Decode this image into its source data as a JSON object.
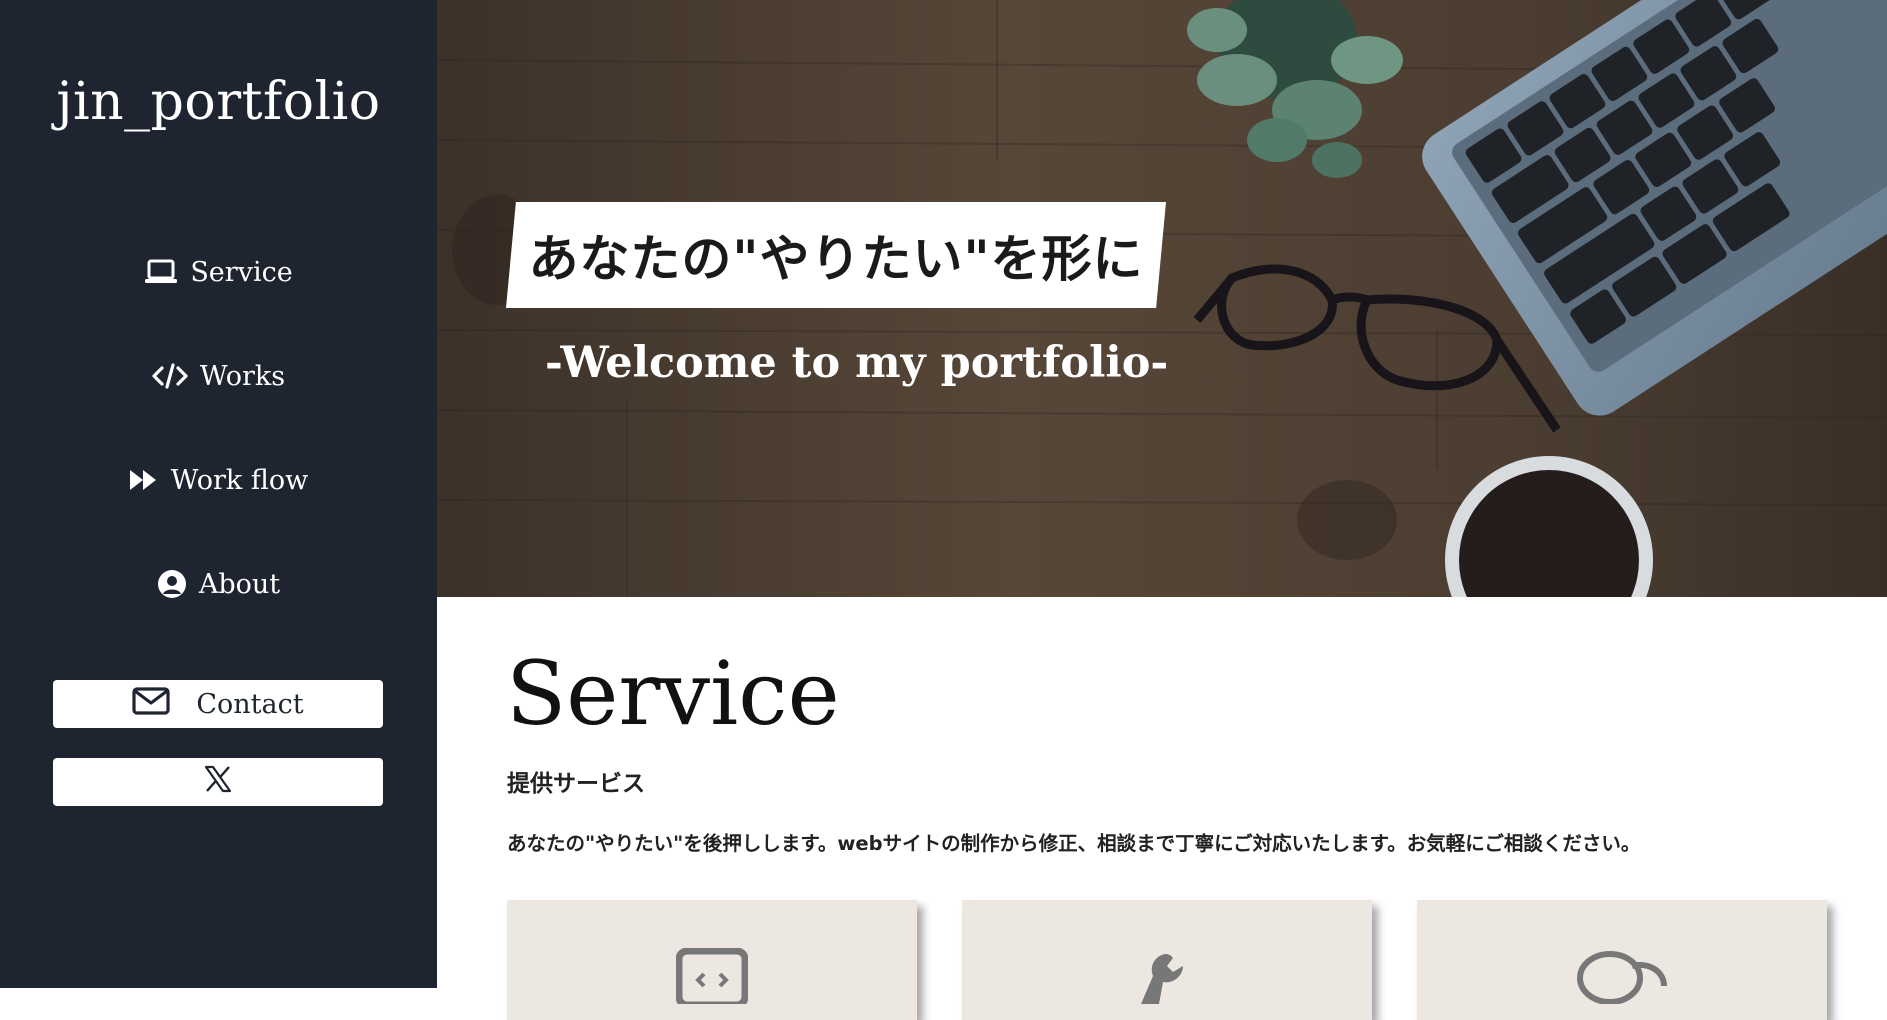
{
  "sidebar": {
    "brand": "jin_portfolio",
    "nav": [
      {
        "label": "Service",
        "icon": "laptop-icon"
      },
      {
        "label": "Works",
        "icon": "code-icon"
      },
      {
        "label": "Work flow",
        "icon": "fast-forward-icon"
      },
      {
        "label": "About",
        "icon": "user-circle-icon"
      }
    ],
    "contact_label": "Contact",
    "contact_icon": "envelope-icon",
    "x_icon": "x-logo-icon"
  },
  "hero": {
    "title": "あなたの\"やりたい\"を形に",
    "subtitle": "-Welcome to my portfolio-"
  },
  "service": {
    "heading": "Service",
    "subheading": "提供サービス",
    "description": "あなたの\"やりたい\"を後押しします。webサイトの制作から修正、相談まで丁寧にご対応いたします。お気軽にご相談ください。",
    "cards": [
      {
        "icon": "code-window-icon"
      },
      {
        "icon": "wrench-icon"
      },
      {
        "icon": "chat-bubbles-icon"
      }
    ]
  },
  "colors": {
    "sidebar_bg": "#1f2530",
    "card_bg": "#ece8e1"
  }
}
